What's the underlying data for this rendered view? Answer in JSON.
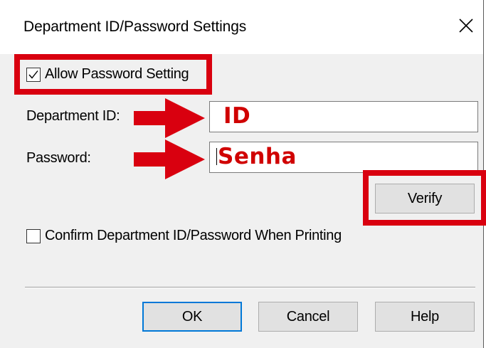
{
  "window": {
    "title": "Department ID/Password Settings"
  },
  "allow_password": {
    "label": "Allow Password Setting",
    "checked": true
  },
  "department_id": {
    "label": "Department ID:",
    "annotation": "ID"
  },
  "password": {
    "label": "Password:",
    "annotation": "Senha"
  },
  "buttons": {
    "verify": "Verify",
    "ok": "OK",
    "cancel": "Cancel",
    "help": "Help"
  },
  "confirm_when_printing": {
    "label": "Confirm Department ID/Password When Printing",
    "checked": false
  },
  "colors": {
    "annotation_red": "#d9000f",
    "default_button_border": "#0078d7",
    "dialog_background": "#f0f0f0"
  },
  "icons": {
    "close": "close-icon",
    "check": "checkmark-icon",
    "arrow": "arrow-right-icon"
  }
}
